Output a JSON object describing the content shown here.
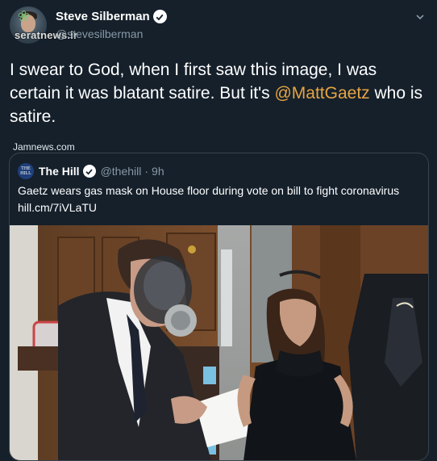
{
  "author": {
    "name": "Steve Silberman",
    "handle": "@stevesilberman"
  },
  "watermark": {
    "top_text": "seratnews.ir",
    "source_text": "Jamnews.com"
  },
  "tweet": {
    "text_before": "I swear to God, when I first saw this image, I was certain it was blatant satire. But it's ",
    "mention": "@MattGaetz",
    "text_after": " who is satire."
  },
  "quoted": {
    "logo_text": "THE HILL",
    "name": "The Hill",
    "handle": "@thehill",
    "separator": "·",
    "time": "9h",
    "text": "Gaetz wears gas mask on House floor during vote on bill to fight coronavirus",
    "link": "hill.cm/7iVLaTU"
  },
  "colors": {
    "background": "#15202b",
    "mention": "#e7a442",
    "secondary_text": "#8899a6",
    "border": "#38444d"
  }
}
